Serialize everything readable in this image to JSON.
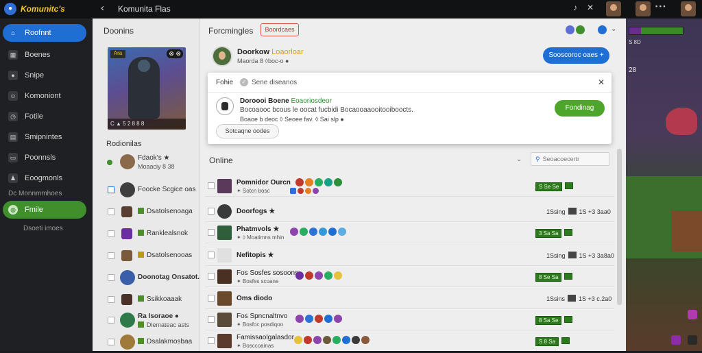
{
  "app": {
    "name": "Komunitc's",
    "window_title": "Komunita Flas"
  },
  "sidebar": {
    "items": [
      {
        "label": "Roofnnt",
        "icon": "home-icon",
        "glyph": "⌂"
      },
      {
        "label": "Boenes",
        "icon": "grid-icon",
        "glyph": "▦"
      },
      {
        "label": "Snipe",
        "icon": "circle-icon",
        "glyph": "●"
      },
      {
        "label": "Komoniont",
        "icon": "people-icon",
        "glyph": "☺"
      },
      {
        "label": "Fotile",
        "icon": "clock-icon",
        "glyph": "◷"
      },
      {
        "label": "Smipnintes",
        "icon": "stack-icon",
        "glyph": "▤"
      },
      {
        "label": "Poonnsls",
        "icon": "chat-icon",
        "glyph": "▭"
      },
      {
        "label": "Eoogmonls",
        "icon": "gamepad-icon",
        "glyph": "♟"
      }
    ],
    "sub_1": "Dc Monnmmhoes",
    "active_green": {
      "label": "Fmile",
      "icon": "globe-icon",
      "glyph": "◍"
    },
    "sub_2": "Dsoeti imoes"
  },
  "left_column": {
    "title": "Doonins",
    "card": {
      "tag": "Ara",
      "footer": "C ▲ 5 2 8 8 8"
    },
    "section_title": "Rodionilas",
    "friends": [
      {
        "name": "Fdaok's ★",
        "sub": "Moaaciy 8 38"
      },
      {
        "name": "Foocke  Scgice oas"
      },
      {
        "name": "Dsatolsenoaga"
      },
      {
        "name": "Ranklealsnok"
      },
      {
        "name": "Dsatolsenooas"
      },
      {
        "name": "Doonotag Onsatot."
      },
      {
        "name": "Ssikkoaaak"
      },
      {
        "name": "Ra Isoraoe ●",
        "sub": "Dlemateac asts"
      },
      {
        "name": "Dsalakmosbaa"
      }
    ]
  },
  "main": {
    "title": "Forcmingles",
    "chip": "Boordcaes",
    "profile": {
      "name": "Doorkow",
      "name_tag": "Loaorloar",
      "sub": "Maorda  8  ◊boc-o  ●"
    },
    "cta_label": "Sooscoroc oaes +",
    "online": {
      "title": "Online",
      "search_placeholder": "Seoacoecertr",
      "rows": [
        {
          "name": "Pomnidor Ourcn",
          "sub": "✦ Sotcn bosc",
          "right_tag": "S Se Se",
          "right_sq": ""
        },
        {
          "name": "Doorfogs ★",
          "right_text": "1Ssing",
          "right_tail": "1S +3 3aa0"
        },
        {
          "name": "Phatmvols ★",
          "sub": "✦ ◊ Moatimns mhin",
          "right_tag": "3 Sa Sa"
        },
        {
          "name": "Nefitopis ★",
          "right_text": "1Ssing",
          "right_tail": "1S +3 3a8a0"
        },
        {
          "name": "Fos Sosfes sosoons",
          "sub": "✦ Bosfes scoane",
          "right_tag": "8 Se Sa"
        },
        {
          "name": "Oms diodo",
          "right_text": "1Ssins",
          "right_tail": "1S +3 c.2a0"
        },
        {
          "name": "Fos Spncnaltnvo",
          "sub": "✦ Bosfoc posdiqoo",
          "right_tag": "8 Sa Se"
        },
        {
          "name": "Famissaolgalasdor",
          "sub": "✦ Bosccoainas",
          "right_tag": "S 8 Sa"
        }
      ]
    }
  },
  "dialog": {
    "title": "Fohie",
    "tag": "Sene diseanos",
    "name": "Doroooi Boene",
    "name_tag": "Eoaoriosdeor",
    "description": "Bocoaooc bcous le oocat fucbidi Bocaooaaooitooiboocts.",
    "meta": "Boaoe b deoc   ◊ Seoee fav.  ◊  Sai slp  ●",
    "secondary_button": "Sotcaqne oodes",
    "primary_button": "Fondinag"
  },
  "game": {
    "hud_1": "S 8D",
    "hud_2": "28",
    "bar_level": 0.22
  },
  "colors": {
    "accent_blue": "#1f6ed4",
    "accent_green": "#4ea52c",
    "chip_red": "#d9534f",
    "gold": "#f3c623"
  }
}
